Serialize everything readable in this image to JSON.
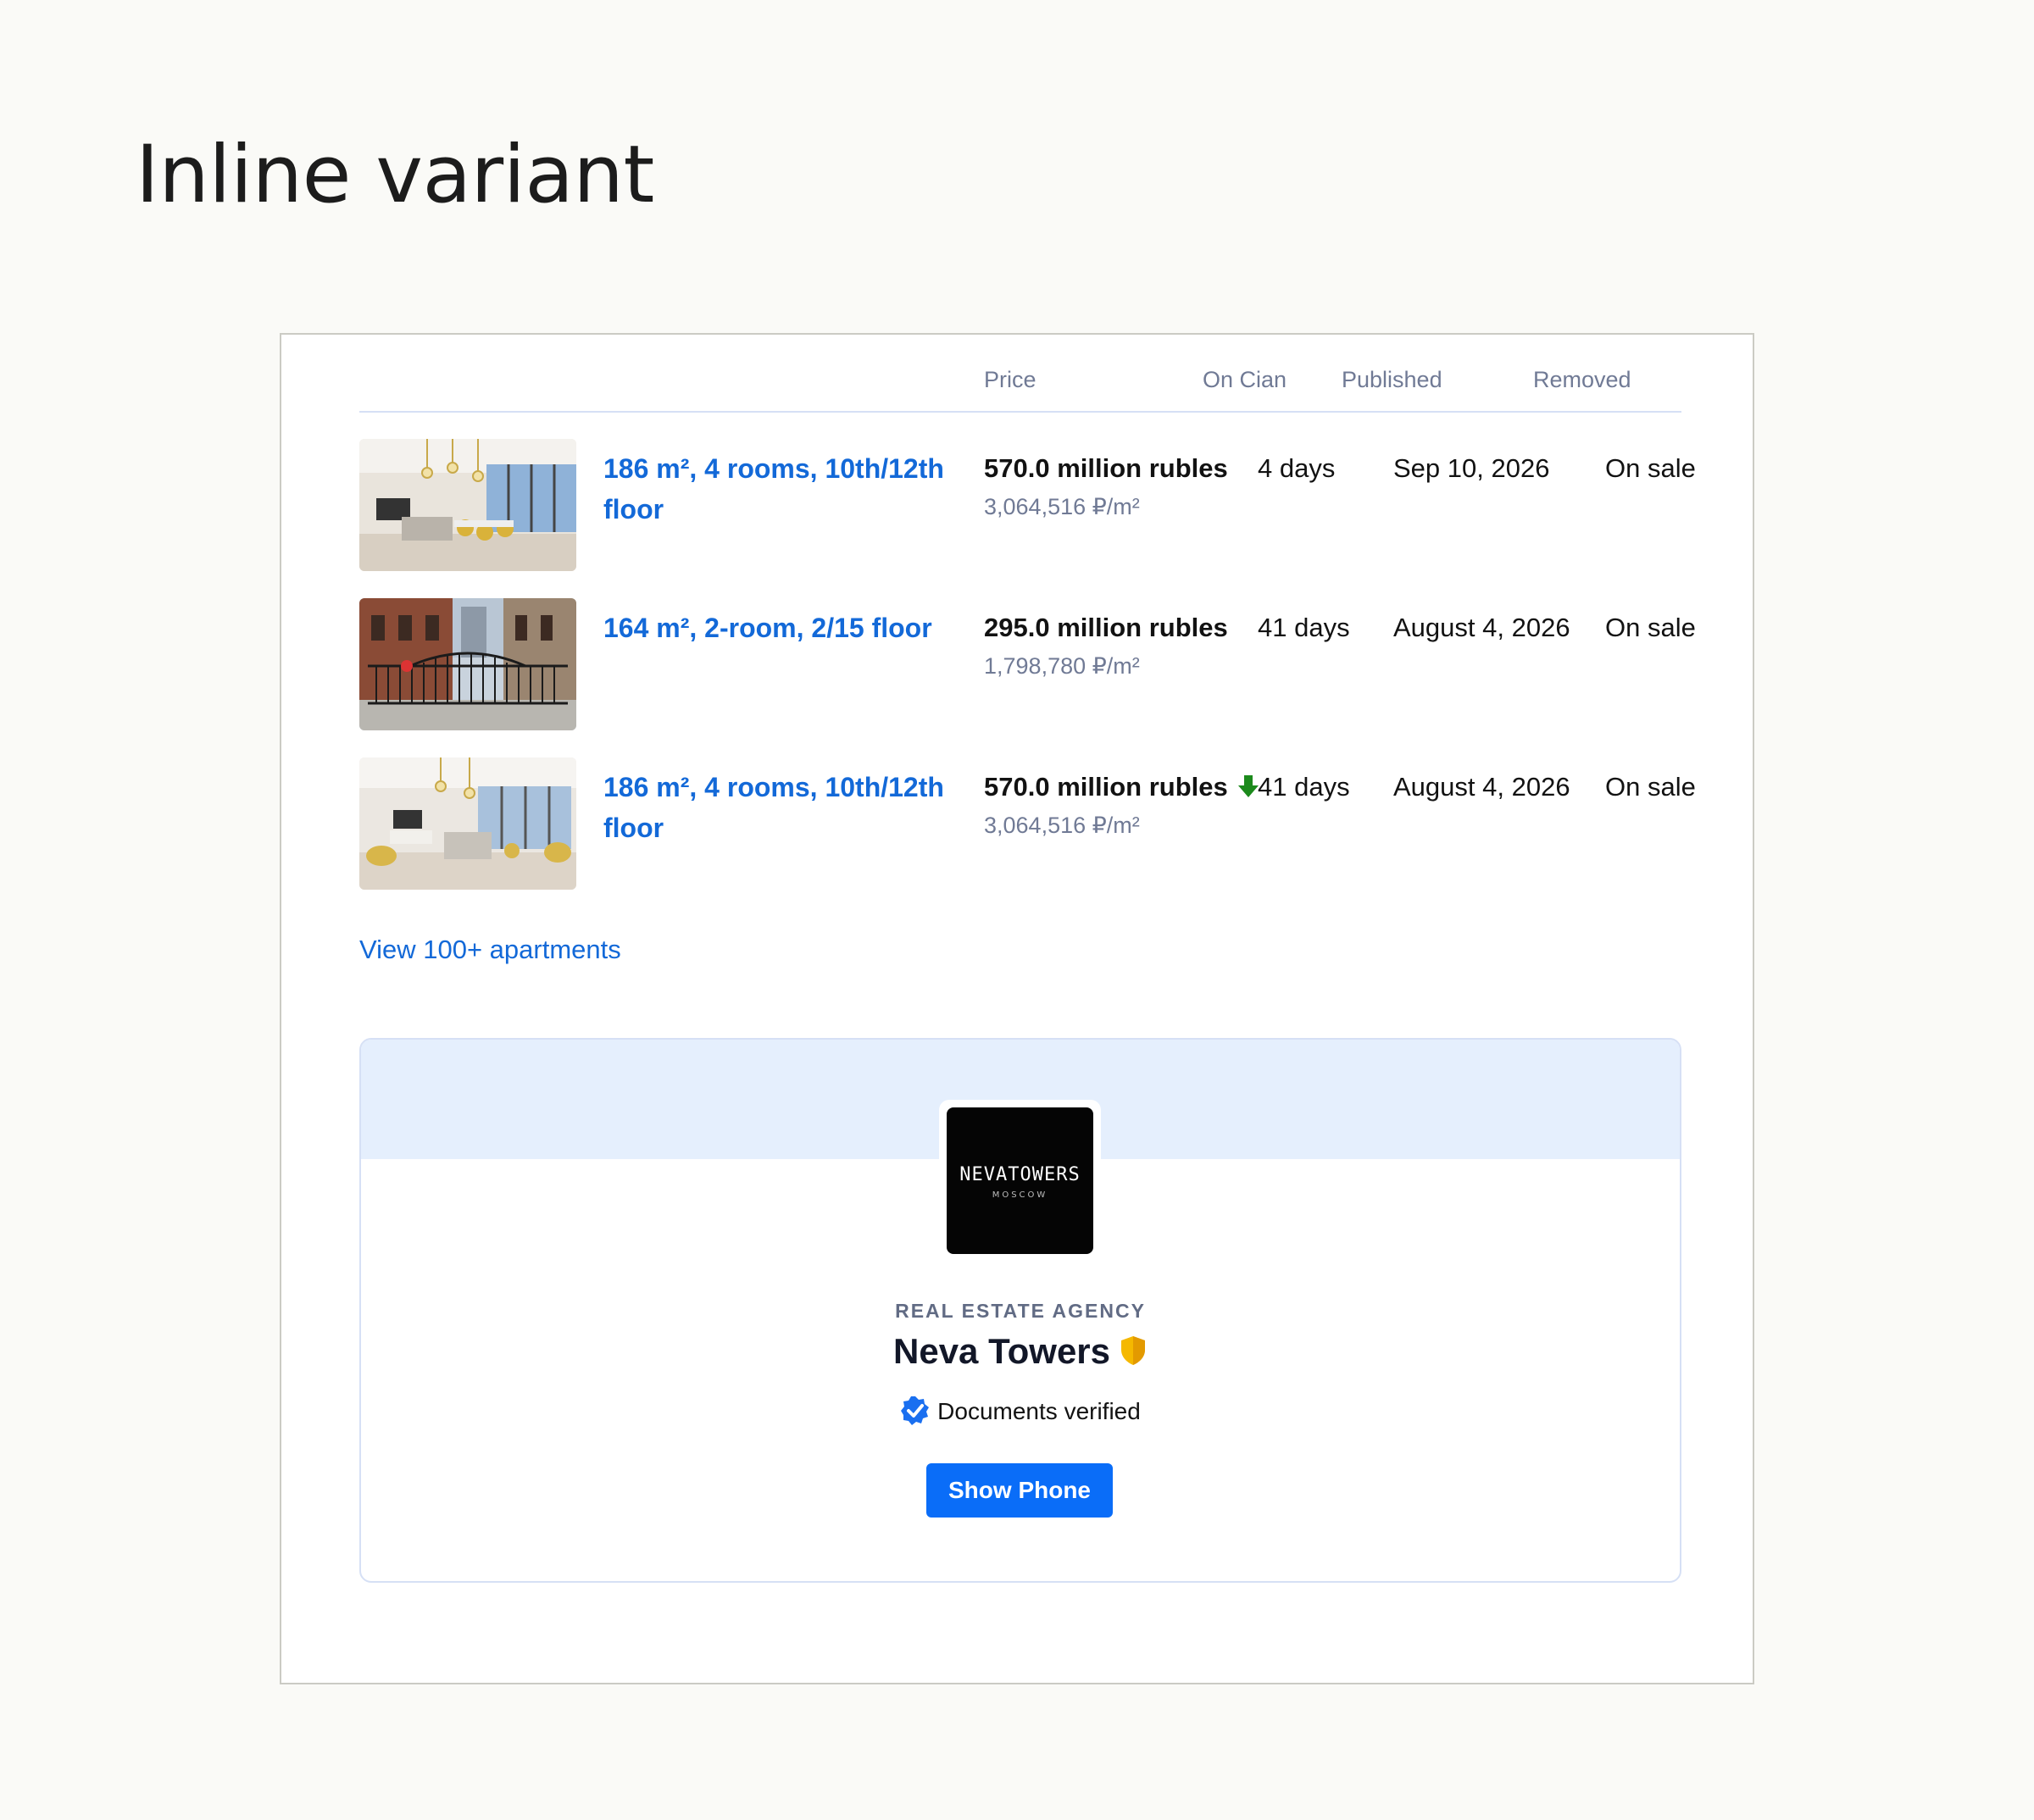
{
  "page": {
    "heading": "Inline variant"
  },
  "table": {
    "headers": {
      "price": "Price",
      "on_cian": "On Cian",
      "published": "Published",
      "removed": "Removed"
    },
    "rows": [
      {
        "title": "186 m², 4 rooms, 10th/12th floor",
        "price": "570.0 million rubles",
        "price_per_sqm": "3,064,516 ₽/m²",
        "price_trend": "",
        "on_cian": "4 days",
        "published": "Sep 10, 2026",
        "removed": "On sale"
      },
      {
        "title": "164 m², 2-room, 2/15 floor",
        "price": "295.0 million rubles",
        "price_per_sqm": "1,798,780 ₽/m²",
        "price_trend": "",
        "on_cian": "41 days",
        "published": "August 4, 2026",
        "removed": "On sale"
      },
      {
        "title": "186 m², 4 rooms, 10th/12th floor",
        "price": "570.0 million rubles",
        "price_per_sqm": "3,064,516 ₽/m²",
        "price_trend": "down-arrow-icon",
        "on_cian": "41 days",
        "published": "August 4, 2026",
        "removed": "On sale"
      }
    ],
    "view_all_link": "View 100+ apartments"
  },
  "agency": {
    "logo_text": "NEVATOWERS",
    "logo_subtext": "MOSCOW",
    "kind": "REAL ESTATE AGENCY",
    "name": "Neva Towers",
    "badge_icon": "shield-icon",
    "verified_icon": "verified-check-icon",
    "verified_label": "Documents verified",
    "show_phone_label": "Show Phone"
  },
  "colors": {
    "link": "#1369d8",
    "button": "#0a6df8",
    "price_drop": "#1c8a1c",
    "card_band": "#e5effd",
    "shield": "#f5b800"
  }
}
